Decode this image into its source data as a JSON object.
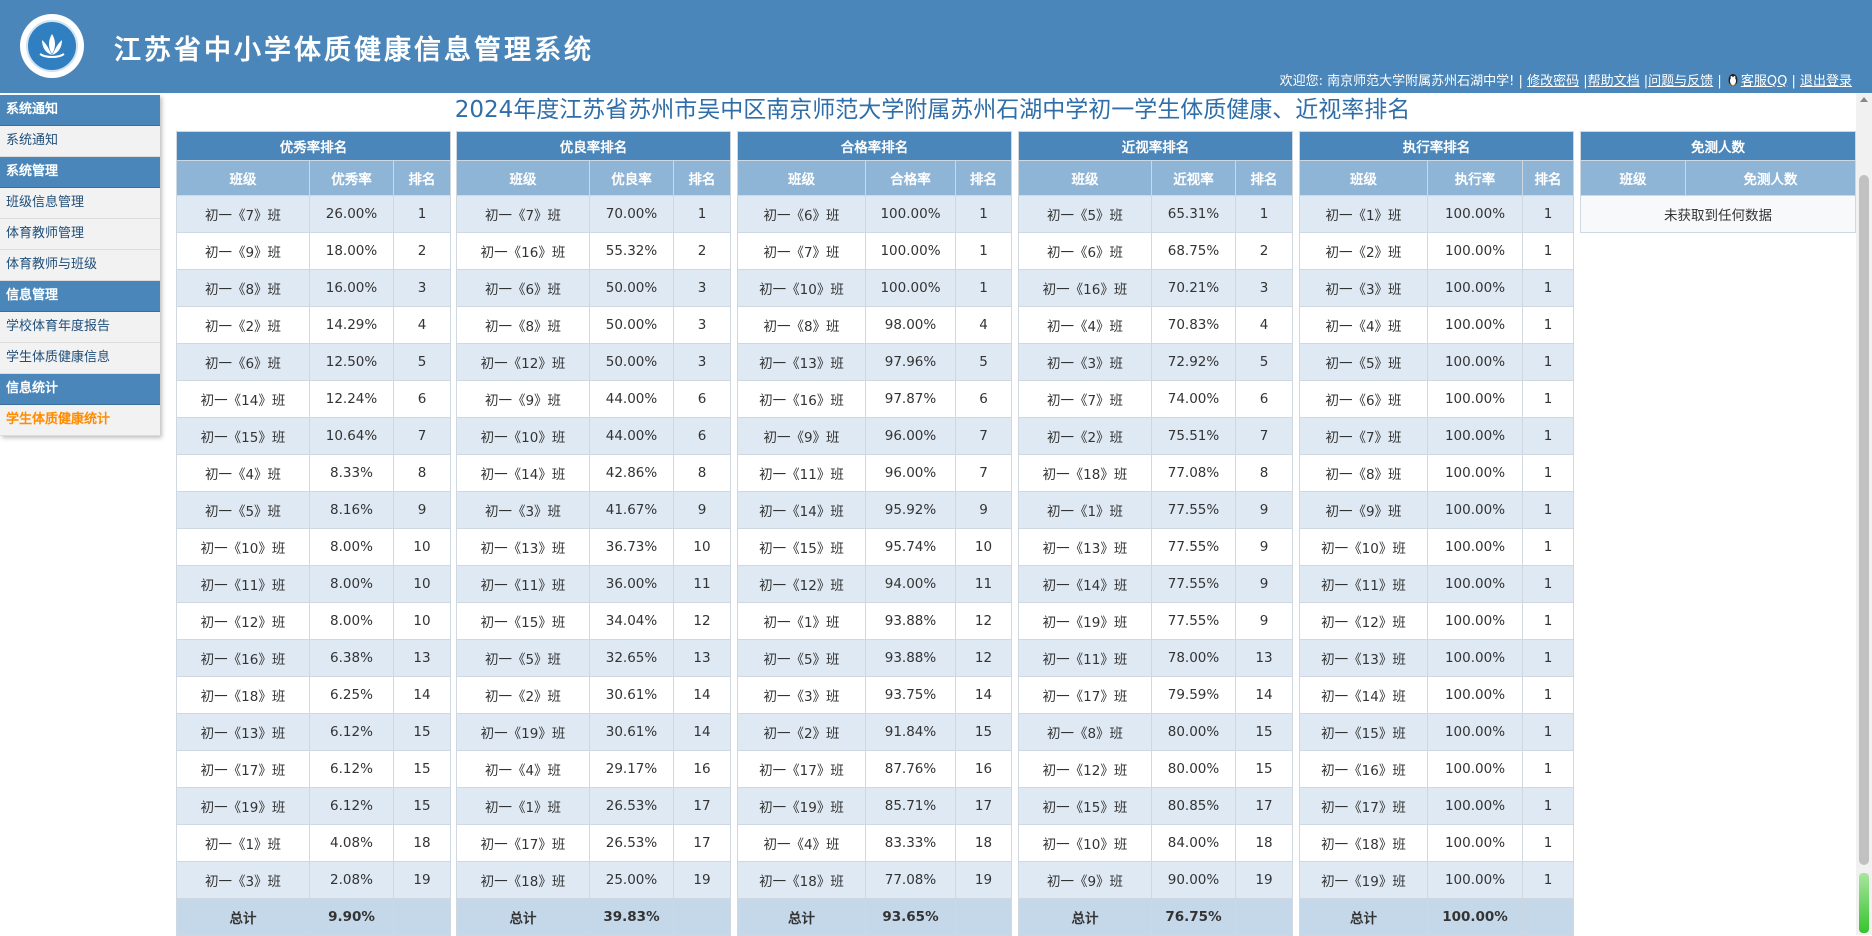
{
  "header": {
    "title": "江苏省中小学体质健康信息管理系统",
    "welcome": "欢迎您: 南京师范大学附属苏州石湖中学!",
    "sep": "|",
    "change_password": "修改密码",
    "help_docs": "帮助文档",
    "feedback": "问题与反馈",
    "service_qq": "客服QQ",
    "logout": "退出登录"
  },
  "sidebar": {
    "groups": [
      {
        "label": "系统通知",
        "items": [
          "系统通知"
        ]
      },
      {
        "label": "系统管理",
        "items": [
          "班级信息管理",
          "体育教师管理",
          "体育教师与班级"
        ]
      },
      {
        "label": "信息管理",
        "items": [
          "学校体育年度报告",
          "学生体质健康信息"
        ]
      },
      {
        "label": "信息统计",
        "items": [
          "学生体质健康统计"
        ]
      }
    ],
    "active_item": "学生体质健康统计"
  },
  "page": {
    "title": "2024年度江苏省苏州市吴中区南京师范大学附属苏州石湖中学初一学生体质健康、近视率排名"
  },
  "tables": [
    {
      "title": "优秀率排名",
      "cols": [
        "班级",
        "优秀率",
        "排名"
      ],
      "rows": [
        [
          "初一《7》班",
          "26.00%",
          "1"
        ],
        [
          "初一《9》班",
          "18.00%",
          "2"
        ],
        [
          "初一《8》班",
          "16.00%",
          "3"
        ],
        [
          "初一《2》班",
          "14.29%",
          "4"
        ],
        [
          "初一《6》班",
          "12.50%",
          "5"
        ],
        [
          "初一《14》班",
          "12.24%",
          "6"
        ],
        [
          "初一《15》班",
          "10.64%",
          "7"
        ],
        [
          "初一《4》班",
          "8.33%",
          "8"
        ],
        [
          "初一《5》班",
          "8.16%",
          "9"
        ],
        [
          "初一《10》班",
          "8.00%",
          "10"
        ],
        [
          "初一《11》班",
          "8.00%",
          "10"
        ],
        [
          "初一《12》班",
          "8.00%",
          "10"
        ],
        [
          "初一《16》班",
          "6.38%",
          "13"
        ],
        [
          "初一《18》班",
          "6.25%",
          "14"
        ],
        [
          "初一《13》班",
          "6.12%",
          "15"
        ],
        [
          "初一《17》班",
          "6.12%",
          "15"
        ],
        [
          "初一《19》班",
          "6.12%",
          "15"
        ],
        [
          "初一《1》班",
          "4.08%",
          "18"
        ],
        [
          "初一《3》班",
          "2.08%",
          "19"
        ]
      ],
      "total": [
        "总计",
        "9.90%",
        ""
      ]
    },
    {
      "title": "优良率排名",
      "cols": [
        "班级",
        "优良率",
        "排名"
      ],
      "rows": [
        [
          "初一《7》班",
          "70.00%",
          "1"
        ],
        [
          "初一《16》班",
          "55.32%",
          "2"
        ],
        [
          "初一《6》班",
          "50.00%",
          "3"
        ],
        [
          "初一《8》班",
          "50.00%",
          "3"
        ],
        [
          "初一《12》班",
          "50.00%",
          "3"
        ],
        [
          "初一《9》班",
          "44.00%",
          "6"
        ],
        [
          "初一《10》班",
          "44.00%",
          "6"
        ],
        [
          "初一《14》班",
          "42.86%",
          "8"
        ],
        [
          "初一《3》班",
          "41.67%",
          "9"
        ],
        [
          "初一《13》班",
          "36.73%",
          "10"
        ],
        [
          "初一《11》班",
          "36.00%",
          "11"
        ],
        [
          "初一《15》班",
          "34.04%",
          "12"
        ],
        [
          "初一《5》班",
          "32.65%",
          "13"
        ],
        [
          "初一《2》班",
          "30.61%",
          "14"
        ],
        [
          "初一《19》班",
          "30.61%",
          "14"
        ],
        [
          "初一《4》班",
          "29.17%",
          "16"
        ],
        [
          "初一《1》班",
          "26.53%",
          "17"
        ],
        [
          "初一《17》班",
          "26.53%",
          "17"
        ],
        [
          "初一《18》班",
          "25.00%",
          "19"
        ]
      ],
      "total": [
        "总计",
        "39.83%",
        ""
      ]
    },
    {
      "title": "合格率排名",
      "cols": [
        "班级",
        "合格率",
        "排名"
      ],
      "rows": [
        [
          "初一《6》班",
          "100.00%",
          "1"
        ],
        [
          "初一《7》班",
          "100.00%",
          "1"
        ],
        [
          "初一《10》班",
          "100.00%",
          "1"
        ],
        [
          "初一《8》班",
          "98.00%",
          "4"
        ],
        [
          "初一《13》班",
          "97.96%",
          "5"
        ],
        [
          "初一《16》班",
          "97.87%",
          "6"
        ],
        [
          "初一《9》班",
          "96.00%",
          "7"
        ],
        [
          "初一《11》班",
          "96.00%",
          "7"
        ],
        [
          "初一《14》班",
          "95.92%",
          "9"
        ],
        [
          "初一《15》班",
          "95.74%",
          "10"
        ],
        [
          "初一《12》班",
          "94.00%",
          "11"
        ],
        [
          "初一《1》班",
          "93.88%",
          "12"
        ],
        [
          "初一《5》班",
          "93.88%",
          "12"
        ],
        [
          "初一《3》班",
          "93.75%",
          "14"
        ],
        [
          "初一《2》班",
          "91.84%",
          "15"
        ],
        [
          "初一《17》班",
          "87.76%",
          "16"
        ],
        [
          "初一《19》班",
          "85.71%",
          "17"
        ],
        [
          "初一《4》班",
          "83.33%",
          "18"
        ],
        [
          "初一《18》班",
          "77.08%",
          "19"
        ]
      ],
      "total": [
        "总计",
        "93.65%",
        ""
      ]
    },
    {
      "title": "近视率排名",
      "cols": [
        "班级",
        "近视率",
        "排名"
      ],
      "rows": [
        [
          "初一《5》班",
          "65.31%",
          "1"
        ],
        [
          "初一《6》班",
          "68.75%",
          "2"
        ],
        [
          "初一《16》班",
          "70.21%",
          "3"
        ],
        [
          "初一《4》班",
          "70.83%",
          "4"
        ],
        [
          "初一《3》班",
          "72.92%",
          "5"
        ],
        [
          "初一《7》班",
          "74.00%",
          "6"
        ],
        [
          "初一《2》班",
          "75.51%",
          "7"
        ],
        [
          "初一《18》班",
          "77.08%",
          "8"
        ],
        [
          "初一《1》班",
          "77.55%",
          "9"
        ],
        [
          "初一《13》班",
          "77.55%",
          "9"
        ],
        [
          "初一《14》班",
          "77.55%",
          "9"
        ],
        [
          "初一《19》班",
          "77.55%",
          "9"
        ],
        [
          "初一《11》班",
          "78.00%",
          "13"
        ],
        [
          "初一《17》班",
          "79.59%",
          "14"
        ],
        [
          "初一《8》班",
          "80.00%",
          "15"
        ],
        [
          "初一《12》班",
          "80.00%",
          "15"
        ],
        [
          "初一《15》班",
          "80.85%",
          "17"
        ],
        [
          "初一《10》班",
          "84.00%",
          "18"
        ],
        [
          "初一《9》班",
          "90.00%",
          "19"
        ]
      ],
      "total": [
        "总计",
        "76.75%",
        ""
      ]
    },
    {
      "title": "执行率排名",
      "cols": [
        "班级",
        "执行率",
        "排名"
      ],
      "rows": [
        [
          "初一《1》班",
          "100.00%",
          "1"
        ],
        [
          "初一《2》班",
          "100.00%",
          "1"
        ],
        [
          "初一《3》班",
          "100.00%",
          "1"
        ],
        [
          "初一《4》班",
          "100.00%",
          "1"
        ],
        [
          "初一《5》班",
          "100.00%",
          "1"
        ],
        [
          "初一《6》班",
          "100.00%",
          "1"
        ],
        [
          "初一《7》班",
          "100.00%",
          "1"
        ],
        [
          "初一《8》班",
          "100.00%",
          "1"
        ],
        [
          "初一《9》班",
          "100.00%",
          "1"
        ],
        [
          "初一《10》班",
          "100.00%",
          "1"
        ],
        [
          "初一《11》班",
          "100.00%",
          "1"
        ],
        [
          "初一《12》班",
          "100.00%",
          "1"
        ],
        [
          "初一《13》班",
          "100.00%",
          "1"
        ],
        [
          "初一《14》班",
          "100.00%",
          "1"
        ],
        [
          "初一《15》班",
          "100.00%",
          "1"
        ],
        [
          "初一《16》班",
          "100.00%",
          "1"
        ],
        [
          "初一《17》班",
          "100.00%",
          "1"
        ],
        [
          "初一《18》班",
          "100.00%",
          "1"
        ],
        [
          "初一《19》班",
          "100.00%",
          "1"
        ]
      ],
      "total": [
        "总计",
        "100.00%",
        ""
      ]
    }
  ],
  "exempt": {
    "title": "免测人数",
    "cols": [
      "班级",
      "免测人数"
    ],
    "empty_text": "未获取到任何数据"
  },
  "colors": {
    "header_bg": "#4a86b9",
    "subheader_bg": "#8fb5d6",
    "row_odd": "#dfe9f3",
    "total_bg": "#c5d8ea",
    "active_menu": "#ff8c00"
  }
}
